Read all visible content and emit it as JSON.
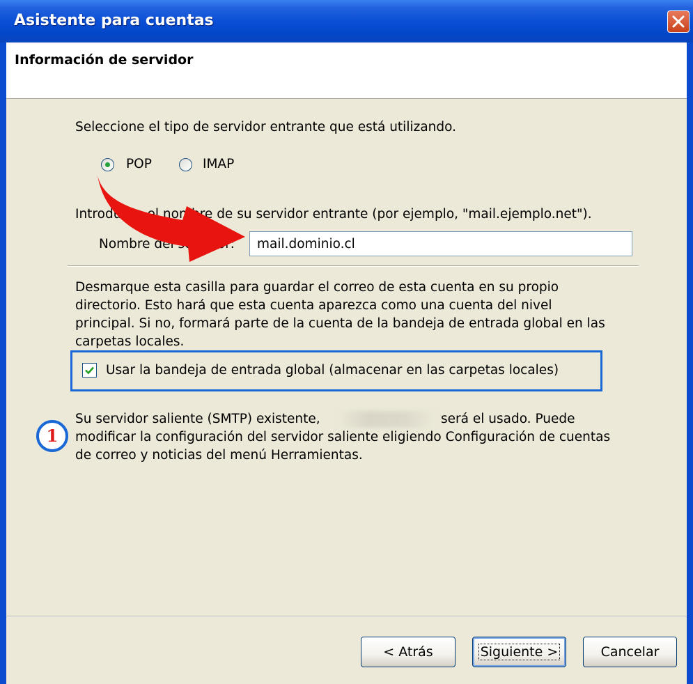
{
  "window": {
    "title": "Asistente para cuentas",
    "close_icon": "close-icon"
  },
  "header": {
    "title": "Información de servidor"
  },
  "incoming": {
    "prompt": "Seleccione el tipo de servidor entrante que está utilizando.",
    "options": [
      {
        "label": "POP",
        "selected": true
      },
      {
        "label": "IMAP",
        "selected": false
      }
    ],
    "server_prompt": "Introduzca el nombre de su servidor entrante (por ejemplo, \"mail.ejemplo.net\").",
    "server_label": "Nombre del servidor:",
    "server_value": "mail.dominio.cl"
  },
  "global_inbox": {
    "description": [
      "Desmarque esta casilla para guardar el correo de esta cuenta en su propio",
      "directorio. Esto hará que esta cuenta aparezca como una cuenta del nivel",
      "principal. Si no, formará parte de la cuenta de la bandeja de entrada global en las",
      "carpetas locales."
    ],
    "checkbox_label": "Usar la bandeja de entrada global (almacenar en las carpetas locales)",
    "checked": true
  },
  "smtp": {
    "line1_before": "Su servidor saliente (SMTP) existente,",
    "line1_after": "será el usado. Puede",
    "line2": "modificar la configuración del servidor saliente eligiendo Configuración de cuentas",
    "line3": "de correo y noticias del menú Herramientas."
  },
  "annotation": {
    "badge_number": "1",
    "highlight_color": "#1a67d6",
    "arrow_color": "#e8140f"
  },
  "buttons": {
    "back": "< Atrás",
    "next": "Siguiente >",
    "cancel": "Cancelar"
  },
  "colors": {
    "titlebar": "#0a4fd6",
    "dialog_bg": "#ece9d8"
  }
}
